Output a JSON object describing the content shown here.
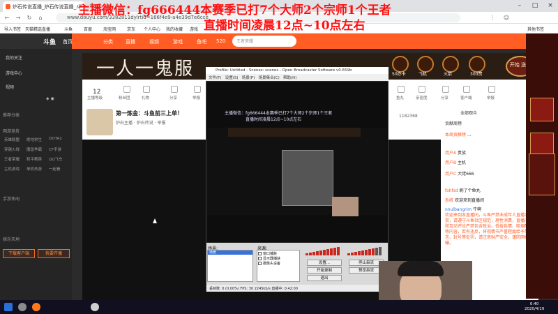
{
  "overlay": {
    "line1": "主播微信：fg666444本赛季已打7个大师2个宗师1个王者",
    "line2": "直播时间凌晨12点~10点左右"
  },
  "browser": {
    "tab_title": "炉石传说直播_炉石传说直播_斗",
    "new_tab": "+",
    "url": "www.douyu.com/3382811dylrtid=166f4e9-a4e39d7e6cce",
    "bookmarks": [
      "导入书签",
      "天猫精选直播",
      "斗鱼",
      "百度",
      "淘宝网",
      "京东",
      "个人中心",
      "我的收藏",
      "游戏",
      "其他书签"
    ]
  },
  "site": {
    "logo": "斗鱼",
    "nav": [
      "首页",
      "分类",
      "直播",
      "视频",
      "游戏",
      "鱼吧"
    ],
    "nav_count": "520",
    "search_placeholder": "王者荣耀",
    "banner_text": "一人一鬼服",
    "gifts": [
      {
        "label": "50办卡"
      },
      {
        "label": "飞机"
      },
      {
        "label": "火箭"
      },
      {
        "label": "300赞"
      }
    ],
    "fansbox": "开始\n送礼"
  },
  "sidebar": {
    "items": [
      "我的关注",
      "游戏中心",
      "视频"
    ],
    "section_follow": "推荐分类",
    "section_hot": "网游竞技",
    "section_mobile": "手游休闲",
    "section_ent": "娱乐天地",
    "games": [
      "英雄联盟",
      "绝地求生",
      "DOTA2",
      "穿越火线",
      "魔兽争霸",
      "CF手游",
      "王者荣耀",
      "和平精英",
      "QQ飞车",
      "主机游戏",
      "单机热游",
      "一起看"
    ],
    "btn_download": "下载客户端",
    "btn_start": "我要开播"
  },
  "room": {
    "level": "12",
    "tools": [
      "主播等级",
      "粉丝团",
      "礼物",
      "分享",
      "举报"
    ],
    "title": "第一炼金：斗鱼前三上单！",
    "streamer": "炉石主播 · 炉石传说 · 举报",
    "viewers": "1182368",
    "right_tools": [
      "鱼丸",
      "亲密度",
      "分享",
      "客户端",
      "举报"
    ]
  },
  "obs": {
    "title": "Profile: Untitled - Scenes: scenes - Open Broadcaster Software v0.659b",
    "menu": [
      "文件(F)",
      "设置(S)",
      "场景(P)",
      "场景集合(C)",
      "帮助(H)"
    ],
    "nested_overlay_1": "主播微信：fg666444本赛季已打7个大师2个宗师1个王者",
    "nested_overlay_2": "直播时间凌晨12点~10点左右",
    "scene_label": "场景:",
    "scene_selected": "场景",
    "source_label": "来源:",
    "sources": [
      "窗口捕获",
      "显示器捕获",
      "摄像头设备"
    ],
    "buttons": [
      "设置...",
      "停止串流",
      "开始录制",
      "预览串流",
      "退出"
    ],
    "status": "丢帧数: 0 (0.00%)    FPS: 30    2245kb/s    直播中: 0:42:00"
  },
  "chat": {
    "header": "全部观众",
    "rank": "贡献周榜",
    "lines": [
      {
        "user": "本周贡献榜",
        "text": "..."
      },
      {
        "user": "用户A",
        "text": "贵族"
      },
      {
        "user": "用户B",
        "text": "主机"
      },
      {
        "user": "用户C",
        "text": "大佬666"
      },
      {
        "user": "fohfsd",
        "text": "刷了个鱼丸"
      },
      {
        "user": "系统",
        "text": "欢迎来到直播间"
      },
      {
        "user": "nnulbangrim",
        "text": "牛啊"
      }
    ],
    "notice": "欢迎来到本直播间，斗鱼严禁未成年人直播或打赏，请遵守斗鱼社区规范，理性消费，直播内容和互动评论严禁包含政治、低俗色情、吸烟酗酒等内容，若有违反，将视情节严重程度给予禁言、封号等处罚，请注意财产安全，谨防网络诈骗。"
  },
  "taskbar": {
    "time": "0:40",
    "date": "2020/4/19"
  }
}
